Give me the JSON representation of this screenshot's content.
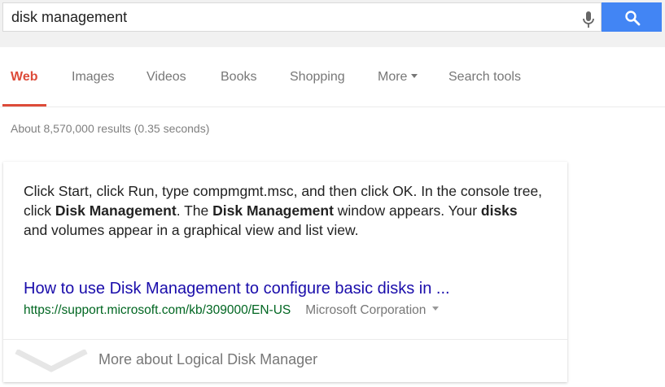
{
  "search": {
    "query": "disk management"
  },
  "icons": {
    "mic": "microphone-icon",
    "search": "search-icon",
    "more_caret": "caret-down-icon",
    "expand": "chevron-down-icon"
  },
  "tabs": [
    {
      "label": "Web",
      "active": true
    },
    {
      "label": "Images"
    },
    {
      "label": "Videos"
    },
    {
      "label": "Books"
    },
    {
      "label": "Shopping"
    },
    {
      "label": "More"
    },
    {
      "label": "Search tools"
    }
  ],
  "stats": "About 8,570,000 results (0.35 seconds)",
  "answer_card": {
    "snippet": [
      {
        "text": "Click Start, click Run, type compmgmt.msc, and then click OK. In the console tree, click ",
        "bold": false
      },
      {
        "text": "Disk Management",
        "bold": true
      },
      {
        "text": ". The ",
        "bold": false
      },
      {
        "text": "Disk Management",
        "bold": true
      },
      {
        "text": " window appears. Your ",
        "bold": false
      },
      {
        "text": "disks",
        "bold": true
      },
      {
        "text": " and volumes appear in a graphical view and list view.",
        "bold": false
      }
    ],
    "link_title": "How to use Disk Management to configure basic disks in ...",
    "url": "https://support.microsoft.com/kb/309000/EN-US",
    "source": "Microsoft Corporation",
    "more_about": "More about Logical Disk Manager"
  },
  "colors": {
    "accent_blue": "#4285f4",
    "tab_active": "#dd4b39",
    "link": "#1a0dab",
    "url": "#006621"
  }
}
